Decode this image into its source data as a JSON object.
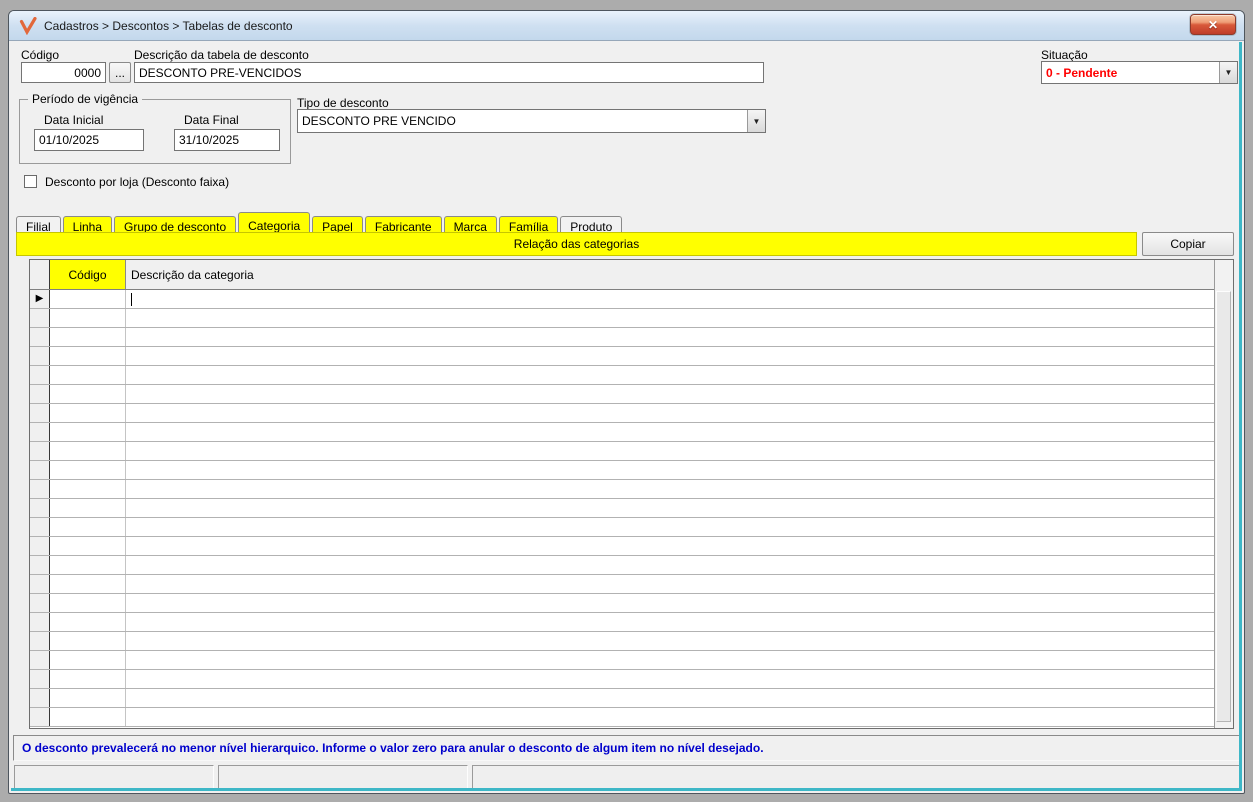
{
  "window": {
    "title": "Cadastros > Descontos > Tabelas de desconto"
  },
  "icons": {
    "logo": "orange-check-v",
    "close": "✕",
    "dropdown": "▼",
    "row_marker": "▶",
    "browse": "..."
  },
  "fields": {
    "codigo": {
      "label": "Código",
      "value": "0000"
    },
    "descricao": {
      "label": "Descrição da tabela de desconto",
      "value": "DESCONTO PRE-VENCIDOS"
    },
    "situacao": {
      "label": "Situação",
      "value": "0 - Pendente"
    },
    "periodo": {
      "legend": "Período de vigência",
      "data_inicial": {
        "label": "Data Inicial",
        "value": "01/10/2025"
      },
      "data_final": {
        "label": "Data Final",
        "value": "31/10/2025"
      }
    },
    "tipo_desconto": {
      "label": "Tipo de desconto",
      "value": "DESCONTO PRE VENCIDO"
    },
    "desconto_por_loja": {
      "label": "Desconto por loja (Desconto faixa)",
      "checked": false
    }
  },
  "tabs": [
    {
      "label": "Filial",
      "highlight": false,
      "active": false
    },
    {
      "label": "Linha",
      "highlight": true,
      "active": false
    },
    {
      "label": "Grupo de desconto",
      "highlight": true,
      "active": false
    },
    {
      "label": "Categoria",
      "highlight": true,
      "active": true
    },
    {
      "label": "Papel",
      "highlight": true,
      "active": false
    },
    {
      "label": "Fabricante",
      "highlight": true,
      "active": false
    },
    {
      "label": "Marca",
      "highlight": true,
      "active": false
    },
    {
      "label": "Família",
      "highlight": true,
      "active": false
    },
    {
      "label": "Produto",
      "highlight": false,
      "active": false
    }
  ],
  "categoria_panel": {
    "banner": "Relação das categorias",
    "copy_button": "Copiar",
    "grid": {
      "columns": {
        "codigo": "Código",
        "descricao": "Descrição da categoria"
      },
      "visible_rows": 23,
      "selected_row_index": 0,
      "rows": []
    }
  },
  "footer": {
    "hint": "O desconto prevalecerá no menor nível hierarquico. Informe o valor zero para anular o desconto de algum item no nível desejado.",
    "status_panels": [
      "",
      "",
      ""
    ]
  },
  "colors": {
    "highlight": "#ffff00",
    "situacao_text": "#ff0000",
    "hint_text": "#0000cc",
    "window_edge_accent": "#3eb7c7",
    "logo": "#e2683b",
    "titlebar": "#cfe0f1"
  }
}
